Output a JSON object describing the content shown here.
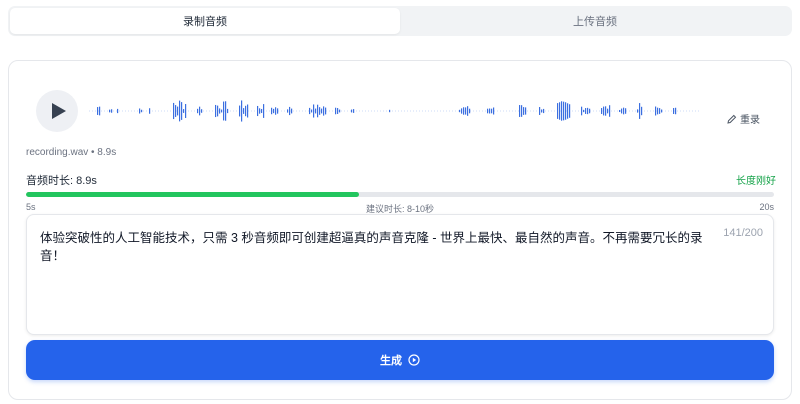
{
  "tabs": [
    {
      "label": "录制音频",
      "active": true
    },
    {
      "label": "上传音频",
      "active": false
    }
  ],
  "player": {
    "play_icon": "play-icon",
    "rerecord_label": "重录",
    "rerecord_icon": "pencil-icon",
    "filename": "recording.wav • 8.9s"
  },
  "duration": {
    "label": "音频时长: 8.9s",
    "status": "长度刚好",
    "value_seconds": 8.9,
    "min_seconds": 5,
    "max_seconds": 20,
    "min_label": "5s",
    "max_label": "20s",
    "suggest_label": "建议时长: 8-10秒",
    "fill_color": "#22c55e"
  },
  "text_input": {
    "value": "体验突破性的人工智能技术，只需 3 秒音频即可创建超逼真的声音克隆 - 世界上最快、最自然的声音。不再需要冗长的录音！",
    "char_count": "141/200"
  },
  "generate": {
    "label": "生成",
    "icon": "play-circle-icon",
    "color": "#2563eb"
  }
}
